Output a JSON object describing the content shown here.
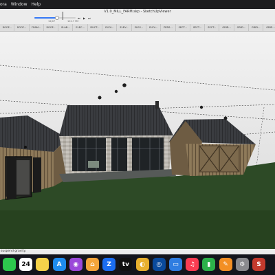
{
  "menubar": {
    "items": [
      "ora",
      "Window",
      "Help"
    ]
  },
  "window": {
    "title": "V1.0_MILL_FARM.skp - SketchUpViewer",
    "time_start": "12/07",
    "time_current": "10:17 PM",
    "timeline_position": 0.55
  },
  "scene_tabs": [
    "ROOF...",
    "ROOF...",
    "FRAM...",
    "ROOF...",
    "SLAB...",
    "ELEC...",
    "DUCT...",
    "ELEV...",
    "ELEV...",
    "ELEV...",
    "ELEV...",
    "PERS...",
    "SECT...",
    "SECT...",
    "SECT...",
    "GRID...",
    "GRID...",
    "GRID...",
    "GRID..."
  ],
  "status": {
    "text": "suspend gravity."
  },
  "dock": {
    "apps": [
      {
        "name": "messages-icon",
        "color": "#2dc84d",
        "glyph": ""
      },
      {
        "name": "calendar-icon",
        "color": "#ffffff",
        "glyph": "24"
      },
      {
        "name": "notes-icon",
        "color": "#f6d24a",
        "glyph": ""
      },
      {
        "name": "app-store-icon",
        "color": "#1e8cf0",
        "glyph": "A"
      },
      {
        "name": "podcasts-icon",
        "color": "#9b48d9",
        "glyph": "◉"
      },
      {
        "name": "home-icon",
        "color": "#f4a43a",
        "glyph": "⌂"
      },
      {
        "name": "zillow-icon",
        "color": "#1b6df2",
        "glyph": "Z"
      },
      {
        "name": "apple-tv-icon",
        "color": "#111111",
        "glyph": "tv"
      },
      {
        "name": "spinner-app-icon",
        "color": "#e8b02e",
        "glyph": "◐"
      },
      {
        "name": "photos-icon",
        "color": "#0a4a9c",
        "glyph": "◎"
      },
      {
        "name": "keynote-icon",
        "color": "#2f7de1",
        "glyph": "▭"
      },
      {
        "name": "music-icon",
        "color": "#fa3c52",
        "glyph": "♫"
      },
      {
        "name": "numbers-icon",
        "color": "#2cb14a",
        "glyph": "▮"
      },
      {
        "name": "pages-icon",
        "color": "#f38f24",
        "glyph": "✎"
      },
      {
        "name": "system-settings-icon",
        "color": "#8a8a8e",
        "glyph": "⚙"
      },
      {
        "name": "sketchup-viewer-icon",
        "color": "#c43a2d",
        "glyph": "S"
      }
    ]
  }
}
